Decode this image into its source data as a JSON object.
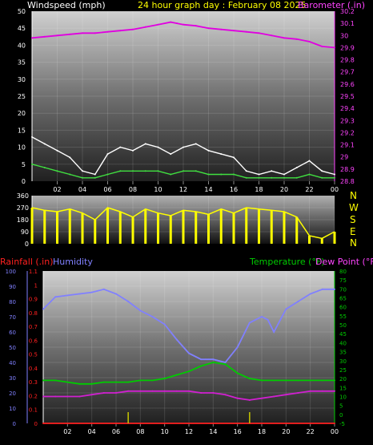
{
  "header": {
    "left_label": "Windspeed (mph)",
    "center_label": "24 hour graph day : February 08 2025",
    "right_label": "Barometer (.in)"
  },
  "chart_data": [
    {
      "type": "line",
      "title": "24 hour graph day : February 08 2025",
      "x_ticks": [
        "02",
        "04",
        "06",
        "08",
        "10",
        "12",
        "14",
        "16",
        "18",
        "20",
        "22",
        "00"
      ],
      "left_axis": {
        "label": "Windspeed (mph)",
        "ylim": [
          0,
          50
        ],
        "ticks": [
          "0",
          "5",
          "10",
          "15",
          "20",
          "25",
          "30",
          "35",
          "40",
          "45",
          "50"
        ]
      },
      "right_axis": {
        "label": "Barometer (.in)",
        "ylim": [
          28.8,
          30.2
        ],
        "ticks": [
          "28.8",
          "28.9",
          "29",
          "29.1",
          "29.2",
          "29.3",
          "29.4",
          "29.5",
          "29.6",
          "29.7",
          "29.8",
          "29.9",
          "30",
          "30.1",
          "30.2"
        ]
      },
      "series": [
        {
          "name": "Barometer (.in)",
          "color": "#e000e0",
          "axis": "right",
          "x": [
            0,
            1,
            2,
            3,
            4,
            5,
            6,
            7,
            8,
            9,
            10,
            11,
            11.5,
            12,
            13,
            14,
            15,
            16,
            17,
            18,
            19,
            20,
            21,
            22,
            22.5,
            23,
            24
          ],
          "y": [
            29.98,
            29.99,
            30.0,
            30.01,
            30.02,
            30.02,
            30.03,
            30.04,
            30.05,
            30.07,
            30.09,
            30.11,
            30.1,
            30.09,
            30.08,
            30.06,
            30.05,
            30.04,
            30.03,
            30.02,
            30.0,
            29.98,
            29.97,
            29.95,
            29.93,
            29.91,
            29.9
          ]
        },
        {
          "name": "wind gust (mph)",
          "color": "#ffffff",
          "axis": "left",
          "x": [
            0,
            1,
            2,
            3,
            4,
            5,
            6,
            7,
            8,
            9,
            10,
            11,
            12,
            13,
            14,
            15,
            16,
            17,
            18,
            19,
            20,
            21,
            22,
            23,
            24
          ],
          "y": [
            13,
            11,
            9,
            7,
            3,
            2,
            8,
            10,
            9,
            11,
            10,
            8,
            10,
            11,
            9,
            8,
            7,
            3,
            2,
            3,
            2,
            4,
            6,
            3,
            2
          ]
        },
        {
          "name": "wind avg (mph)",
          "color": "#40e040",
          "axis": "left",
          "x": [
            0,
            1,
            2,
            3,
            4,
            5,
            6,
            7,
            8,
            9,
            10,
            11,
            12,
            13,
            14,
            15,
            16,
            17,
            18,
            19,
            20,
            21,
            22,
            23,
            24
          ],
          "y": [
            5,
            4,
            3,
            2,
            1,
            1,
            2,
            3,
            3,
            3,
            3,
            2,
            3,
            3,
            2,
            2,
            2,
            1,
            1,
            1,
            1,
            1,
            2,
            1,
            1
          ]
        }
      ]
    },
    {
      "type": "scatter",
      "title": "",
      "x_ticks": [],
      "left_axis": {
        "label": "",
        "ylim": [
          0,
          360
        ],
        "ticks": [
          "0",
          "90",
          "180",
          "270",
          "360"
        ]
      },
      "compass_labels": [
        "N",
        "W",
        "S",
        "E",
        "N"
      ],
      "series": [
        {
          "name": "wind direction",
          "color": "#ffff00",
          "x": [
            0,
            1,
            2,
            3,
            4,
            5,
            6,
            7,
            8,
            9,
            10,
            11,
            12,
            13,
            14,
            15,
            16,
            17,
            18,
            19,
            20,
            21,
            22,
            23,
            24
          ],
          "y": [
            270,
            250,
            240,
            260,
            230,
            180,
            270,
            240,
            200,
            260,
            230,
            210,
            250,
            240,
            220,
            260,
            230,
            270,
            260,
            250,
            240,
            200,
            60,
            40,
            90
          ]
        }
      ]
    },
    {
      "type": "line",
      "title": "",
      "x_ticks": [
        "02",
        "04",
        "06",
        "08",
        "10",
        "12",
        "14",
        "16",
        "18",
        "20",
        "22",
        "00"
      ],
      "left_axis_1": {
        "label": "Rainfall (.in)",
        "color": "#ff2020",
        "ylim": [
          0,
          1.1
        ],
        "ticks": [
          "0",
          "0.1",
          "0.2",
          "0.3",
          "0.4",
          "0.5",
          "0.6",
          "0.7",
          "0.8",
          "0.9",
          "1",
          "1.1"
        ]
      },
      "left_axis_2": {
        "label": "Humidity",
        "color": "#8080ff",
        "ylim": [
          0,
          100
        ],
        "ticks": [
          "0",
          "10",
          "20",
          "30",
          "40",
          "50",
          "60",
          "70",
          "80",
          "90",
          "100"
        ]
      },
      "right_axis": {
        "label": "Temperature (°F)",
        "label2": "Dew Point (°F)",
        "ylim": [
          -5,
          80
        ],
        "ticks": [
          "-5",
          "0",
          "5",
          "10",
          "15",
          "20",
          "25",
          "30",
          "35",
          "40",
          "45",
          "50",
          "55",
          "60",
          "65",
          "70",
          "75",
          "80"
        ]
      },
      "series": [
        {
          "name": "Humidity",
          "color": "#8080ff",
          "axis": "left_2",
          "x": [
            0,
            1,
            2,
            3,
            4,
            5,
            6,
            7,
            8,
            9,
            10,
            11,
            12,
            13,
            14,
            15,
            16,
            17,
            18,
            18.5,
            19,
            20,
            21,
            22,
            23,
            24
          ],
          "y": [
            75,
            83,
            84,
            85,
            86,
            88,
            85,
            80,
            74,
            70,
            65,
            55,
            46,
            42,
            42,
            40,
            50,
            66,
            70,
            68,
            60,
            75,
            80,
            85,
            88,
            88
          ]
        },
        {
          "name": "Temperature (°F)",
          "color": "#00cc00",
          "axis": "right",
          "x": [
            0,
            1,
            2,
            3,
            4,
            5,
            6,
            7,
            8,
            9,
            10,
            11,
            12,
            13,
            14,
            15,
            16,
            17,
            18,
            19,
            20,
            21,
            22,
            23,
            24
          ],
          "y": [
            19,
            19,
            18,
            17,
            17,
            18,
            18,
            18,
            19,
            19,
            20,
            22,
            24,
            27,
            29,
            28,
            23,
            20,
            19,
            19,
            19,
            19,
            19,
            19,
            19
          ]
        },
        {
          "name": "Dew Point (°F)",
          "color": "#d020d0",
          "axis": "right",
          "x": [
            0,
            1,
            2,
            3,
            4,
            5,
            6,
            7,
            8,
            9,
            10,
            11,
            12,
            13,
            14,
            15,
            16,
            17,
            18,
            19,
            20,
            21,
            22,
            23,
            24
          ],
          "y": [
            10,
            10,
            10,
            10,
            11,
            12,
            12,
            13,
            13,
            13,
            13,
            13,
            13,
            12,
            12,
            11,
            9,
            8,
            9,
            10,
            11,
            12,
            13,
            13,
            13
          ]
        },
        {
          "name": "Rainfall (.in)",
          "color": "#ff2020",
          "axis": "left_1",
          "x": [
            0,
            24
          ],
          "y": [
            0,
            0
          ]
        }
      ]
    }
  ]
}
